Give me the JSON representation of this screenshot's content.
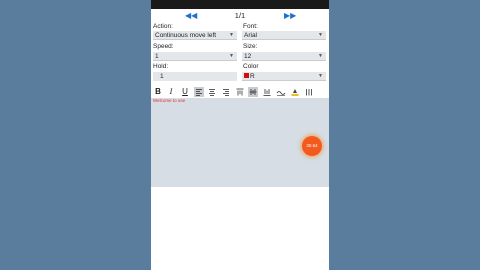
{
  "pager": {
    "prev_icon": "double-left-arrow",
    "page_text": "1/1",
    "next_icon": "double-right-arrow",
    "accent": "#1f6fd0"
  },
  "form": {
    "action_label": "Action:",
    "action_value": "Continuous move left",
    "font_label": "Font:",
    "font_value": "Arial",
    "speed_label": "Speed:",
    "speed_value": "1",
    "size_label": "Size:",
    "size_value": "12",
    "hold_label": "Hold:",
    "hold_value": "1",
    "color_label": "Color",
    "color_value": "R",
    "color_swatch": "#d01010"
  },
  "toolbar": {
    "bold": "B",
    "italic": "I",
    "underline": "U",
    "active_color": "#c9ccd0",
    "highlight_color": "#e8c020"
  },
  "editor": {
    "text": "Welcome to use",
    "text_color": "#e03030",
    "background": "#d6dde4"
  },
  "fab": {
    "label": "30.64",
    "color": "#f25a1e"
  }
}
